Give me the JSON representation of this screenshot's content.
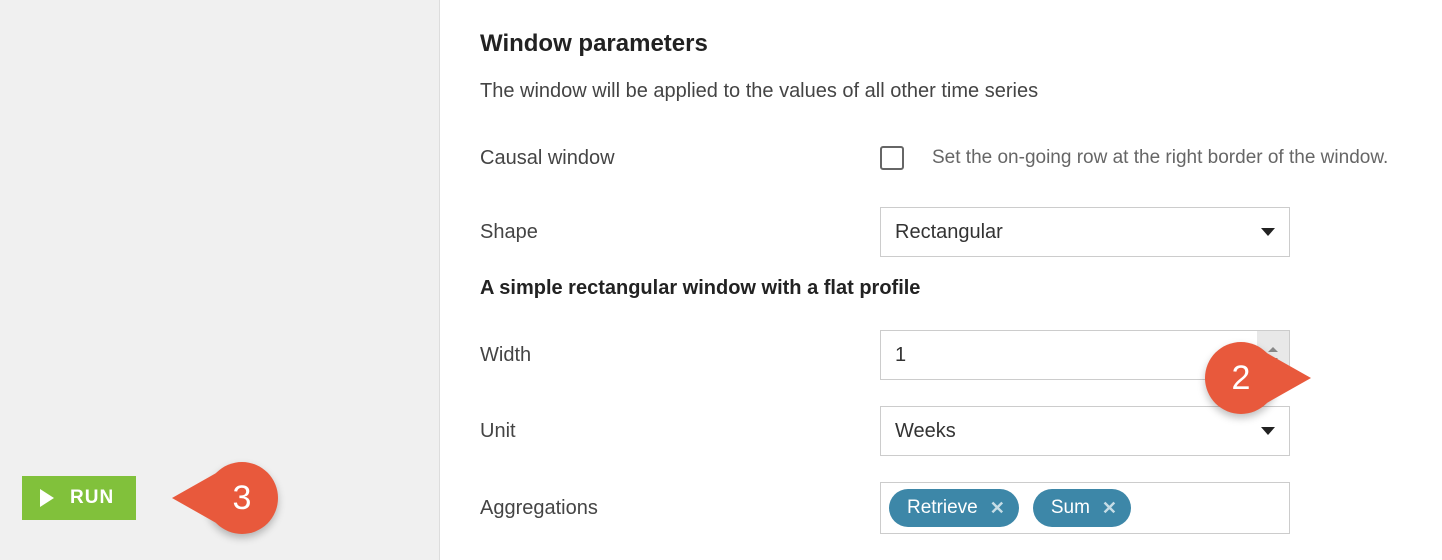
{
  "sidebar": {
    "run_label": "RUN"
  },
  "annotations": {
    "b2": "2",
    "b3": "3"
  },
  "panel": {
    "title": "Window parameters",
    "description": "The window will be applied to the values of all other time series",
    "causal": {
      "label": "Causal window",
      "help": "Set the on-going row at the right border of the window."
    },
    "shape": {
      "label": "Shape",
      "value": "Rectangular",
      "description": "A simple rectangular window with a flat profile"
    },
    "width": {
      "label": "Width",
      "value": "1"
    },
    "unit": {
      "label": "Unit",
      "value": "Weeks"
    },
    "aggregations": {
      "label": "Aggregations",
      "tags": [
        "Retrieve",
        "Sum"
      ]
    }
  }
}
